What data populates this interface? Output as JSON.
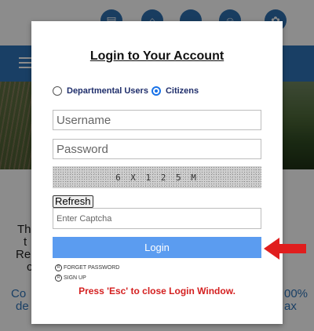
{
  "background": {
    "text_lines": [
      "Th",
      "t",
      "Re",
      "c"
    ],
    "blue_text_left": [
      "Co",
      "de"
    ],
    "blue_text_right": [
      "00%",
      "ax"
    ]
  },
  "modal": {
    "title": "Login to Your Account",
    "user_types": [
      {
        "label": "Departmental Users",
        "selected": false
      },
      {
        "label": "Citizens",
        "selected": true
      }
    ],
    "username_placeholder": "Username",
    "password_placeholder": "Password",
    "captcha_text": "6 X 1 2 5 M",
    "refresh_label": "Refresh",
    "captcha_placeholder": "Enter Captcha",
    "login_label": "Login",
    "forget_password": "FORGET PASSWORD",
    "sign_up": "SIGN UP",
    "esc_note": "Press 'Esc' to close Login Window."
  },
  "icons": {
    "top_bar": [
      "id-card-icon",
      "home-icon",
      "chat-icon",
      "group-icon",
      "emblem-icon"
    ],
    "hamburger": "hamburger-icon",
    "arrow": "red-arrow-icon"
  },
  "colors": {
    "brand_blue": "#2f74b8",
    "login_button": "#5b9cf0",
    "esc_note": "#d42020",
    "arrow": "#e01e1e"
  }
}
